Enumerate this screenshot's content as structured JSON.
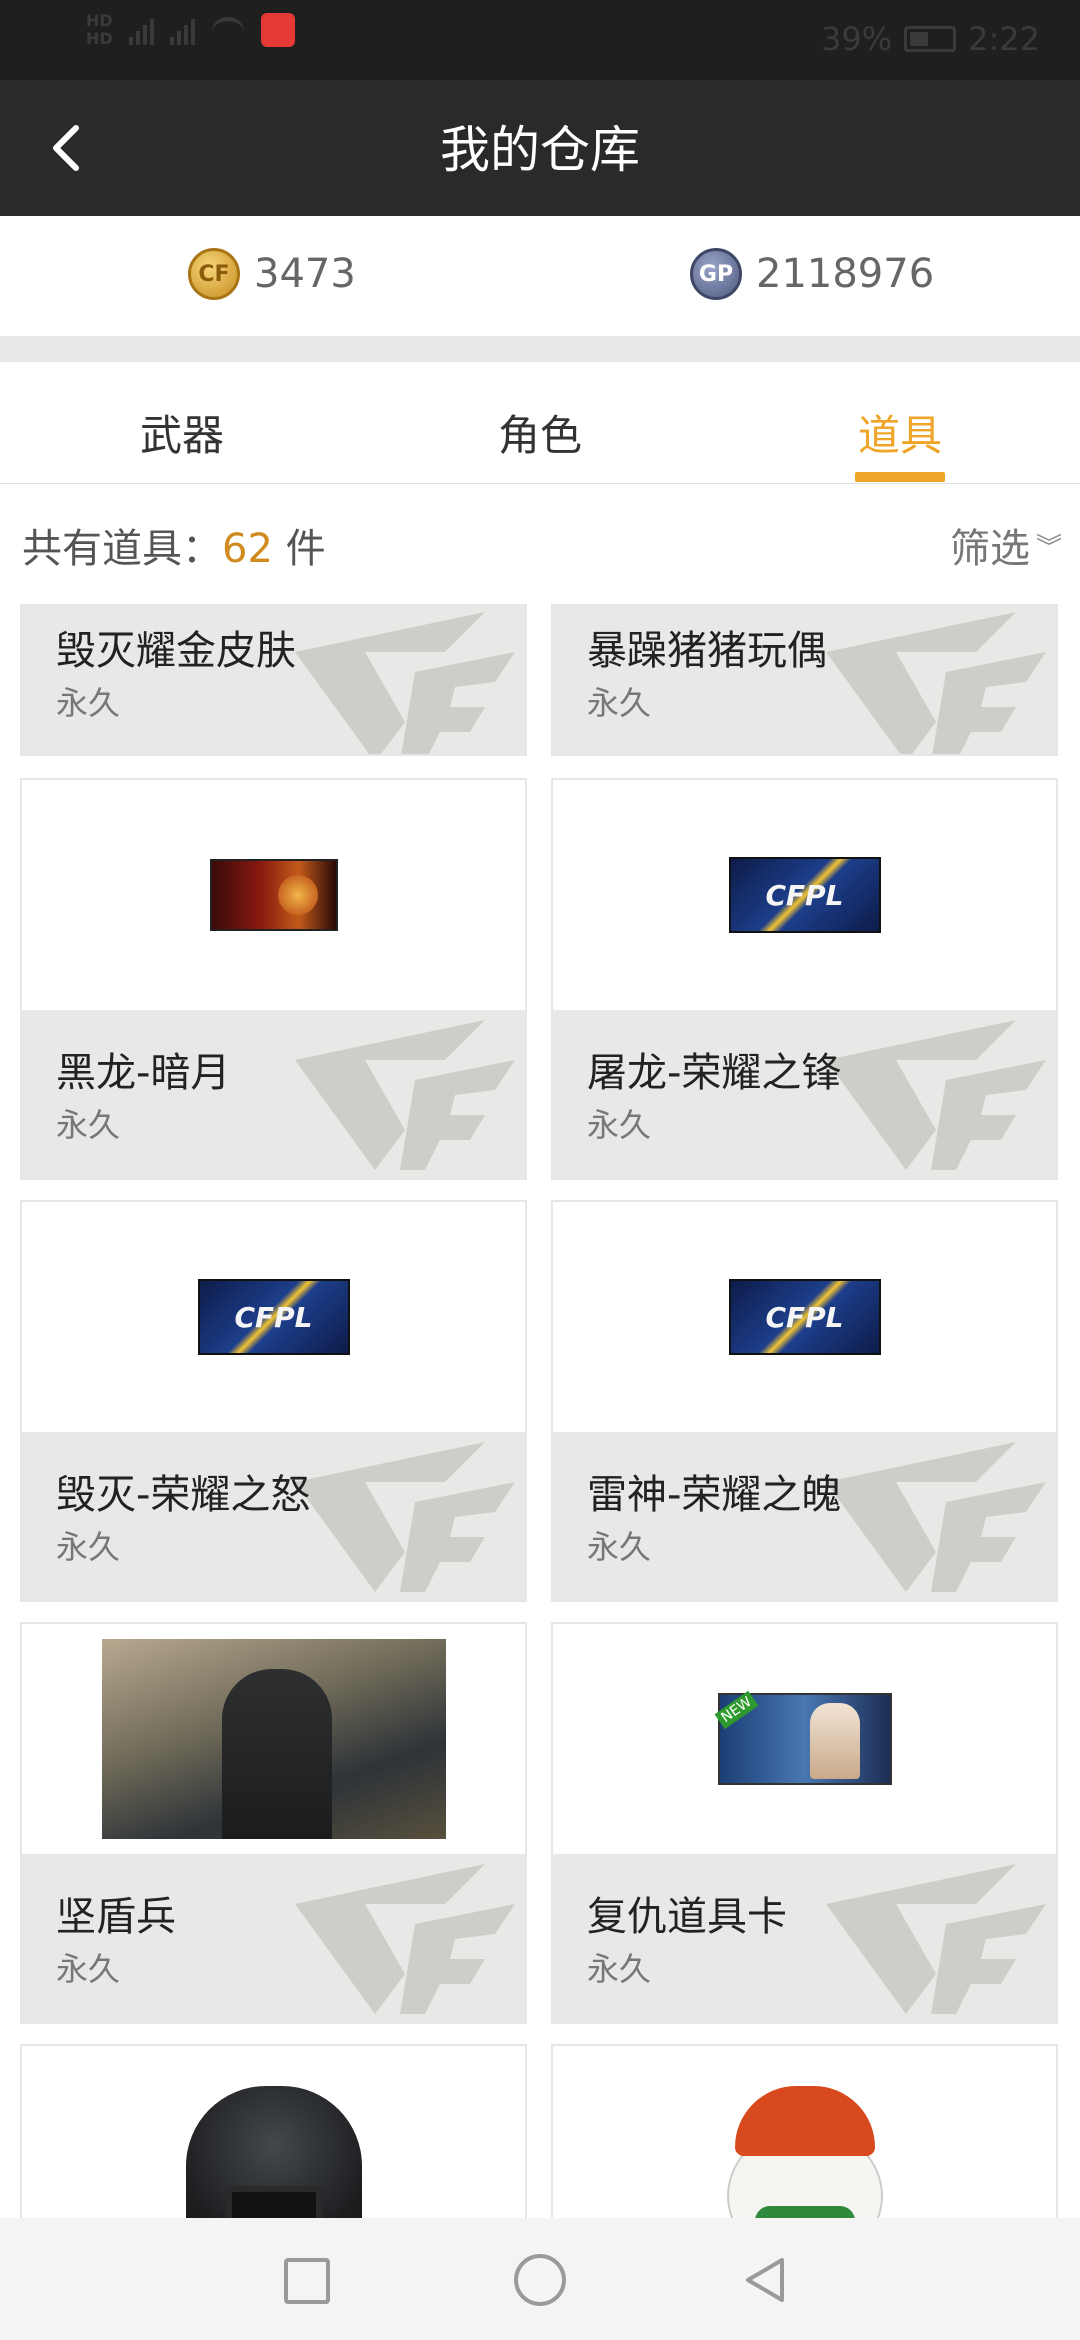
{
  "status_bar": {
    "hd_top": "HD",
    "hd_bottom": "HD",
    "network1": "4G",
    "network2": "4G",
    "app_badge": "",
    "battery_pct": "39%",
    "time": "2:22"
  },
  "nav": {
    "title": "我的仓库",
    "back_icon": "chevron-left-icon"
  },
  "currency": {
    "cf_icon": "cf-coin-icon",
    "cf_icon_text": "CF",
    "cf_amount": "3473",
    "gp_icon": "gp-coin-icon",
    "gp_icon_text": "GP",
    "gp_amount": "2118976"
  },
  "tabs": {
    "weapons": "武器",
    "roles": "角色",
    "items": "道具",
    "active": "道具",
    "accent_color": "#f0a528"
  },
  "summary": {
    "label_prefix": "共有道具：",
    "count": "62",
    "unit": "件",
    "filter_label": "筛选",
    "filter_icon": "double-chevron-down-icon"
  },
  "items": [
    {
      "name": "毁灭耀金皮肤",
      "duration": "永久",
      "thumb": "none"
    },
    {
      "name": "暴躁猪猪玩偶",
      "duration": "永久",
      "thumb": "none"
    },
    {
      "name": "黑龙-暗月",
      "duration": "永久",
      "thumb": "weapon-skin-red"
    },
    {
      "name": "屠龙-荣耀之锋",
      "duration": "永久",
      "thumb": "cfpl-banner"
    },
    {
      "name": "毁灭-荣耀之怒",
      "duration": "永久",
      "thumb": "cfpl-banner"
    },
    {
      "name": "雷神-荣耀之魄",
      "duration": "永久",
      "thumb": "cfpl-banner"
    },
    {
      "name": "坚盾兵",
      "duration": "永久",
      "thumb": "soldier-portrait"
    },
    {
      "name": "复仇道具卡",
      "duration": "永久",
      "thumb": "item-card"
    },
    {
      "name": "",
      "duration": "",
      "thumb": "helmet"
    },
    {
      "name": "",
      "duration": "",
      "thumb": "egg-mascot"
    }
  ],
  "watermark": "CF",
  "cfpl_text": "CFPL",
  "system_nav": {
    "recent": "square-icon",
    "home": "circle-icon",
    "back": "triangle-back-icon"
  }
}
